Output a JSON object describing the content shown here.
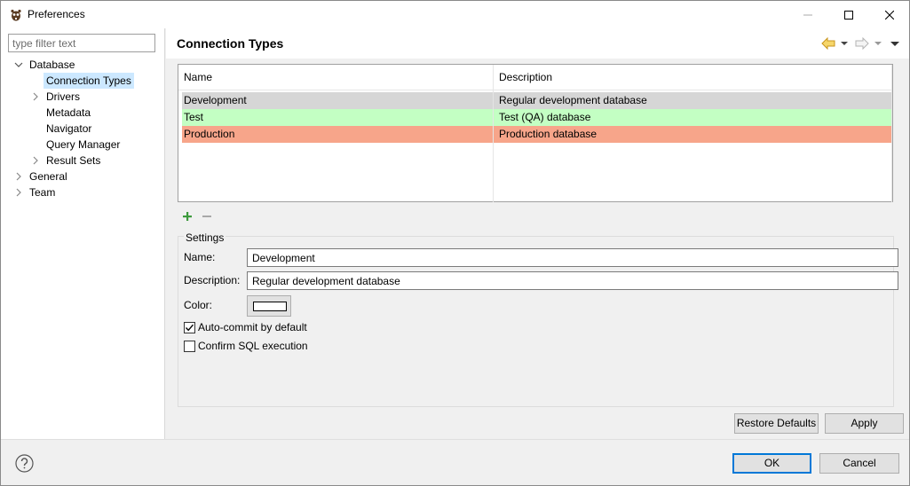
{
  "window": {
    "title": "Preferences"
  },
  "filter": {
    "placeholder": "type filter text"
  },
  "tree": {
    "database": "Database",
    "connection_types": "Connection Types",
    "drivers": "Drivers",
    "metadata": "Metadata",
    "navigator": "Navigator",
    "query_manager": "Query Manager",
    "result_sets": "Result Sets",
    "general": "General",
    "team": "Team"
  },
  "page": {
    "title": "Connection Types"
  },
  "table": {
    "headers": [
      "Name",
      "Description"
    ],
    "rows": [
      {
        "name": "Development",
        "description": "Regular development database",
        "color": "#d6d6d6"
      },
      {
        "name": "Test",
        "description": "Test (QA) database",
        "color": "#c3ffc3"
      },
      {
        "name": "Production",
        "description": "Production database",
        "color": "#f7a58a"
      }
    ]
  },
  "settings": {
    "legend": "Settings",
    "name_label": "Name:",
    "name_value": "Development",
    "description_label": "Description:",
    "description_value": "Regular development database",
    "color_label": "Color:",
    "color_value": "#ffffff",
    "autocommit_label": "Auto-commit by default",
    "autocommit_checked": true,
    "confirm_label": "Confirm SQL execution",
    "confirm_checked": false
  },
  "buttons": {
    "restore_defaults": "Restore Defaults",
    "apply": "Apply",
    "ok": "OK",
    "cancel": "Cancel"
  },
  "icons": {
    "app": "dbeaver-beaver-icon",
    "back": "back-arrow-icon",
    "forward": "forward-arrow-icon",
    "menu": "view-menu-icon",
    "add": "plus-icon",
    "remove": "minus-icon",
    "help": "help-icon"
  },
  "colors": {
    "accent": "#0078d7",
    "selection": "#cce8ff",
    "add_green": "#3d9a3d",
    "nav_yellow": "#d9a521"
  }
}
